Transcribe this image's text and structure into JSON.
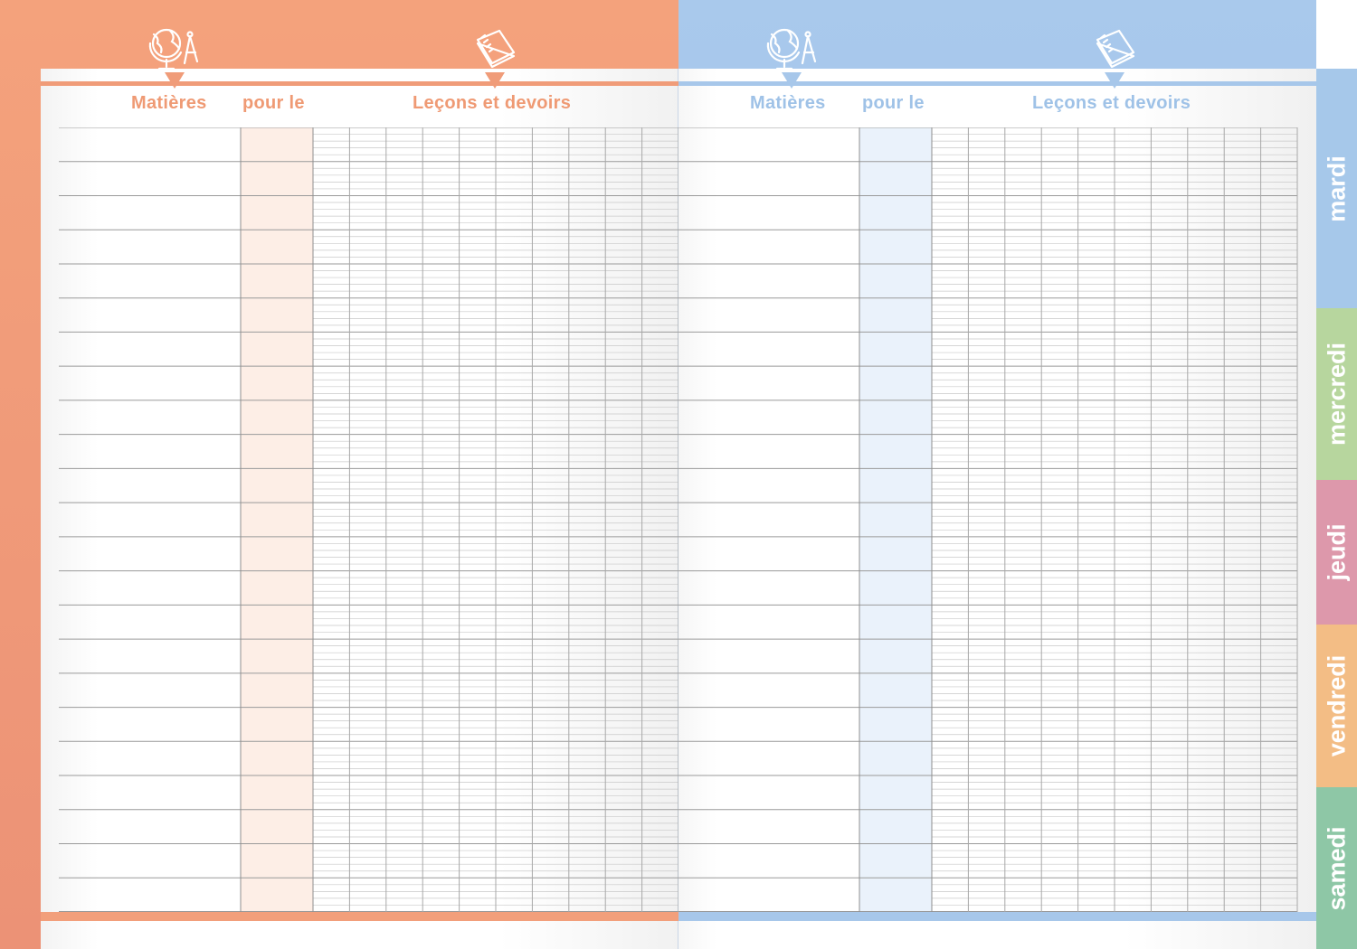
{
  "left_page": {
    "headers": {
      "subjects": "Matières",
      "due_for": "pour le",
      "lessons": "Leçons et devoirs"
    },
    "accent": "#ef9a74",
    "pour_le_tint": "#fdeee6",
    "icons": [
      "globe-compass-icon",
      "notebook-icon"
    ]
  },
  "right_page": {
    "headers": {
      "subjects": "Matières",
      "due_for": "pour le",
      "lessons": "Leçons et devoirs"
    },
    "accent": "#9fc2e7",
    "pour_le_tint": "#eaf2fb",
    "icons": [
      "globe-compass-icon",
      "notebook-icon"
    ]
  },
  "day_tabs": [
    {
      "label": "mardi",
      "color": "#a6c8ea"
    },
    {
      "label": "mercredi",
      "color": "#b7d69e"
    },
    {
      "label": "jeudi",
      "color": "#dd98ab"
    },
    {
      "label": "vendredi",
      "color": "#f3bd85"
    },
    {
      "label": "samedi",
      "color": "#8ec7a6"
    }
  ],
  "grid": {
    "row_count": 23,
    "lessons_columns": 10,
    "sub_lines_per_row": 5
  }
}
